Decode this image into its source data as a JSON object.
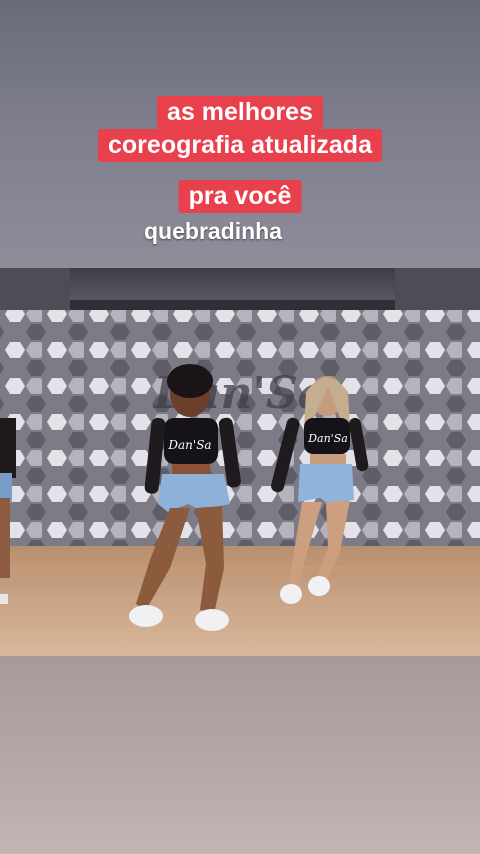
{
  "captions": {
    "line1": "as melhores",
    "line2": "coreografia atualizada",
    "line3": "pra você",
    "plain": "quebradinha"
  },
  "video": {
    "wall_logo_text": "Dan'Sa",
    "shirt_logo_text": "Dan'Sa"
  },
  "colors": {
    "caption_bg": "#e8404d",
    "caption_text": "#ffffff"
  }
}
